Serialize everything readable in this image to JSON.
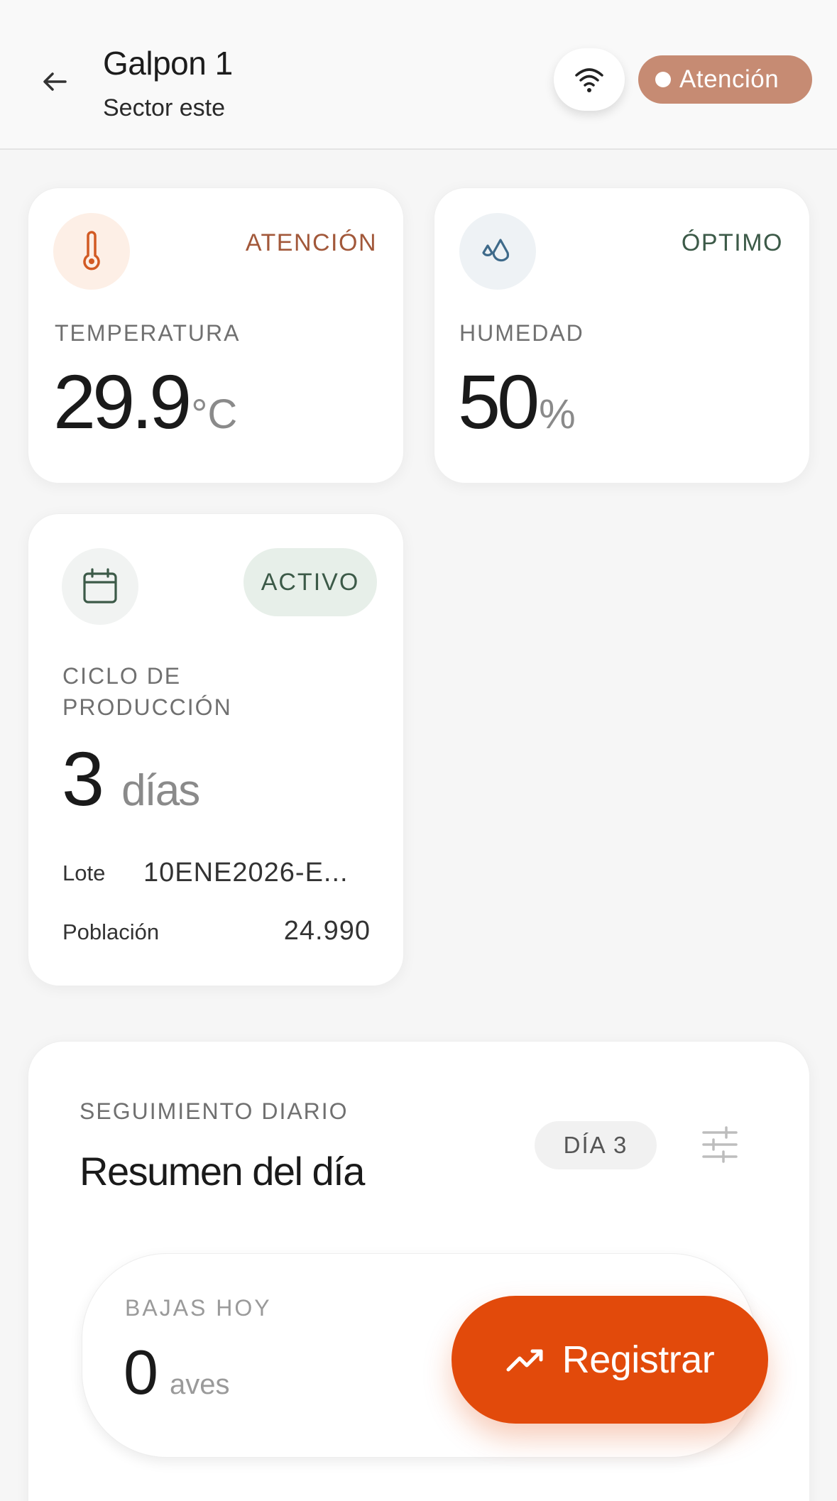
{
  "header": {
    "title": "Galpon 1",
    "subtitle": "Sector este",
    "alert_label": "Atención",
    "wifi_icon": "wifi-icon",
    "back_icon": "arrow-left-icon"
  },
  "temperature": {
    "status": "ATENCIÓN",
    "label": "TEMPERATURA",
    "value": "29.9",
    "unit": "°C",
    "icon": "thermometer-icon"
  },
  "humidity": {
    "status": "ÓPTIMO",
    "label": "HUMEDAD",
    "value": "50",
    "unit": "%",
    "icon": "droplets-icon"
  },
  "cycle": {
    "badge": "ACTIVO",
    "label_line1": "CICLO DE",
    "label_line2": "PRODUCCIÓN",
    "value": "3",
    "unit": "días",
    "lote_label": "Lote",
    "lote_value": "10ENE2026-E...",
    "poblacion_label": "Población",
    "poblacion_value": "24.990",
    "icon": "calendar-icon"
  },
  "daily": {
    "eyebrow": "SEGUIMIENTO DIARIO",
    "title": "Resumen del día",
    "day_badge": "DÍA 3",
    "filter_icon": "sliders-icon",
    "bajas_label": "BAJAS HOY",
    "bajas_value": "0",
    "bajas_unit": "aves"
  },
  "fab": {
    "label": "Registrar",
    "icon": "trending-up-icon"
  },
  "colors": {
    "accent": "#e24a0b",
    "attention": "#a2583a",
    "optimal": "#3c5a48",
    "alert_pill": "#c68b73"
  }
}
